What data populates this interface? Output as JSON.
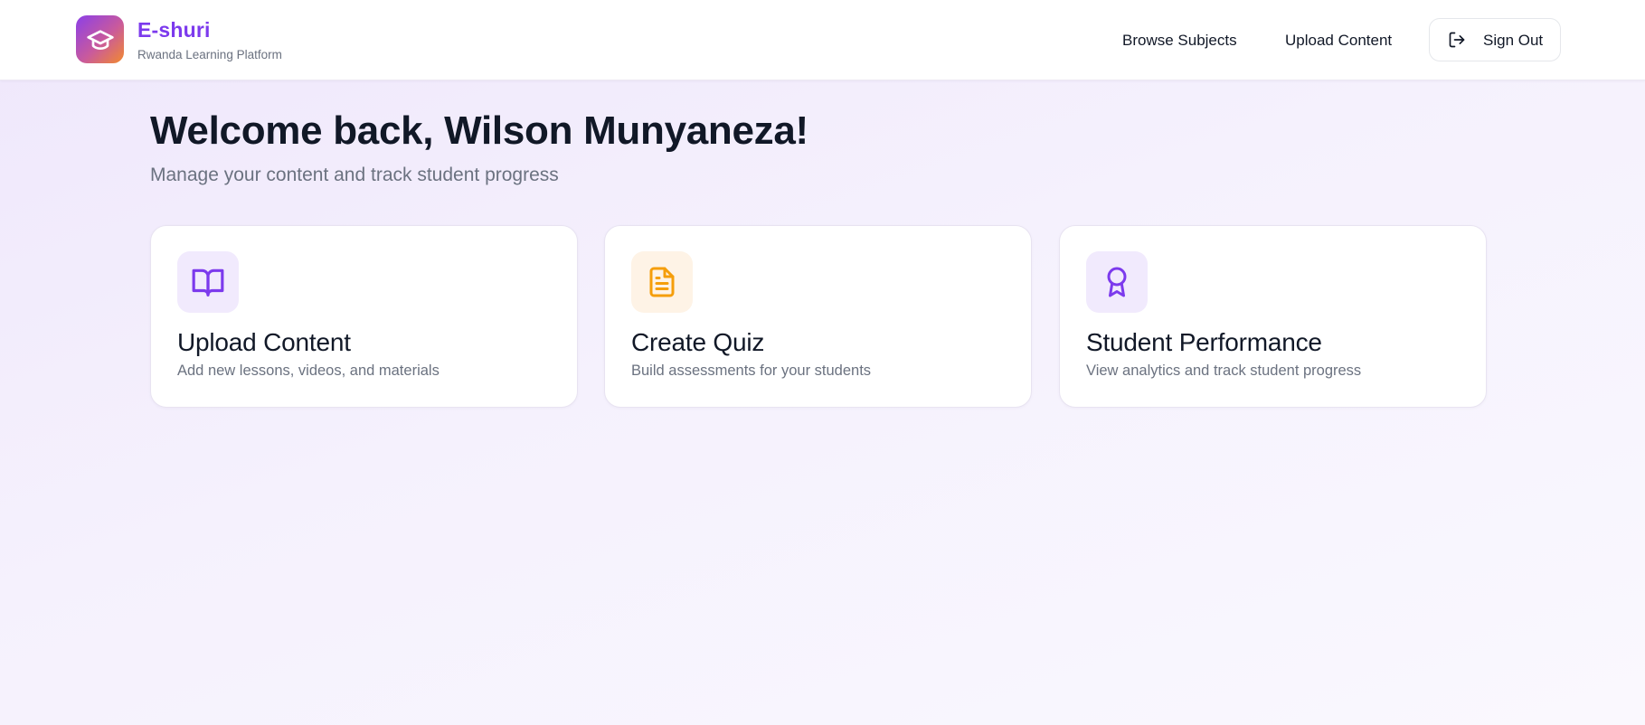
{
  "brand": {
    "name": "E-shuri",
    "tagline": "Rwanda Learning Platform",
    "icon": "graduation-cap-icon"
  },
  "nav": {
    "browse_subjects": "Browse Subjects",
    "upload_content": "Upload Content",
    "sign_out": "Sign Out",
    "sign_out_icon": "logout-icon"
  },
  "welcome": {
    "title": "Welcome back, Wilson Munyaneza!",
    "subtitle": "Manage your content and track student progress"
  },
  "cards": [
    {
      "title": "Upload Content",
      "description": "Add new lessons, videos, and materials",
      "icon": "book-open-icon",
      "accent": "#7c3aed"
    },
    {
      "title": "Create Quiz",
      "description": "Build assessments for your students",
      "icon": "file-text-icon",
      "accent": "#f59e0b"
    },
    {
      "title": "Student Performance",
      "description": "View analytics and track student progress",
      "icon": "award-icon",
      "accent": "#7c3aed"
    }
  ],
  "colors": {
    "brand_purple": "#7c3aed",
    "brand_orange": "#f28a2e",
    "text_dark": "#111827",
    "text_muted": "#6b7280"
  }
}
